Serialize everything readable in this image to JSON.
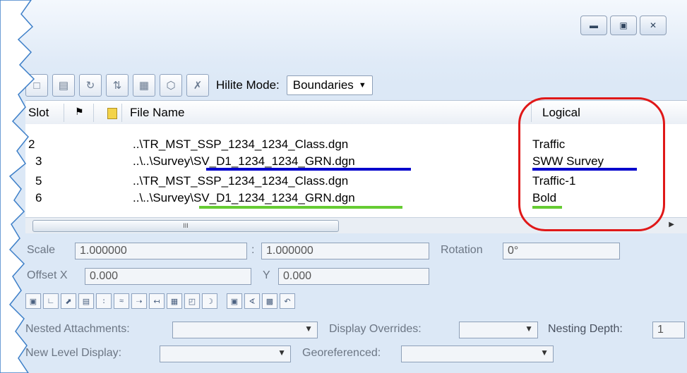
{
  "window": {
    "controls": {
      "minimize_icon": "minimize-icon",
      "maximize_icon": "maximize-icon",
      "close_icon": "close-icon"
    }
  },
  "toolbar": {
    "icons": [
      "attach-icon",
      "detach-icon",
      "reload-icon",
      "exchange-icon",
      "settings-icon",
      "model-icon",
      "remove-icon"
    ],
    "hilite_label": "Hilite Mode:",
    "hilite_value": "Boundaries"
  },
  "list": {
    "headers": {
      "slot": "Slot",
      "flag_icon": "flag-icon",
      "file_icon": "file-icon",
      "file_name": "File Name",
      "logical": "Logical"
    },
    "rows": [
      {
        "slot": "2",
        "file": "..\\TR_MST_SSP_1234_1234_Class.dgn",
        "logical": "Traffic"
      },
      {
        "slot": "3",
        "file": "..\\..\\Survey\\SV_D1_1234_1234_GRN.dgn",
        "logical": "SWW Survey"
      },
      {
        "slot": "5",
        "file": "..\\TR_MST_SSP_1234_1234_Class.dgn",
        "logical": "Traffic-1"
      },
      {
        "slot": "6",
        "file": "..\\..\\Survey\\SV_D1_1234_1234_GRN.dgn",
        "logical": "Bold"
      }
    ],
    "scroll_thumb_label": "III"
  },
  "annotations": {
    "blue": "#0000cc",
    "green": "#66cc33",
    "red": "#e01818"
  },
  "props": {
    "scale_label": "Scale",
    "scale_value": "1.000000",
    "colon": ":",
    "scale_value2": "1.000000",
    "rotation_label": "Rotation",
    "rotation_value": "0°",
    "offset_label": "Offset X",
    "offset_x": "0.000",
    "y_label": "Y",
    "offset_y": "0.000",
    "nested_label": "Nested Attachments:",
    "display_overrides_label": "Display Overrides:",
    "nesting_depth_label": "Nesting Depth:",
    "nesting_depth_value": "1",
    "new_level_label": "New Level Display:",
    "georef_label": "Georeferenced:"
  }
}
